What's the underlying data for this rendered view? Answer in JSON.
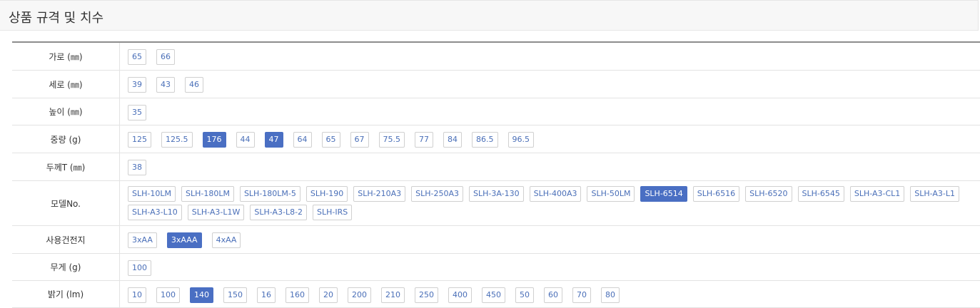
{
  "header": {
    "title": "상품 규격 및 치수"
  },
  "rows": [
    {
      "label": "가로 (㎜)",
      "values": [
        "65",
        "66"
      ],
      "selected": []
    },
    {
      "label": "세로 (㎜)",
      "values": [
        "39",
        "43",
        "46"
      ],
      "selected": []
    },
    {
      "label": "높이 (㎜)",
      "values": [
        "35"
      ],
      "selected": []
    },
    {
      "label": "중량 (g)",
      "values": [
        "125",
        "125.5",
        "176",
        "44",
        "47",
        "64",
        "65",
        "67",
        "75.5",
        "77",
        "84",
        "86.5",
        "96.5"
      ],
      "selected": [
        "176",
        "47"
      ]
    },
    {
      "label": "두께T (㎜)",
      "values": [
        "38"
      ],
      "selected": []
    },
    {
      "label": "모델No.",
      "values": [
        "SLH-10LM",
        "SLH-180LM",
        "SLH-180LM-5",
        "SLH-190",
        "SLH-210A3",
        "SLH-250A3",
        "SLH-3A-130",
        "SLH-400A3",
        "SLH-50LM",
        "SLH-6514",
        "SLH-6516",
        "SLH-6520",
        "SLH-6545",
        "SLH-A3-CL1",
        "SLH-A3-L1",
        "SLH-A3-L10",
        "SLH-A3-L1W",
        "SLH-A3-L8-2",
        "SLH-IRS"
      ],
      "selected": [
        "SLH-6514"
      ]
    },
    {
      "label": "사용건전지",
      "values": [
        "3xAA",
        "3xAAA",
        "4xAA"
      ],
      "selected": [
        "3xAAA"
      ]
    },
    {
      "label": "무게 (g)",
      "values": [
        "100"
      ],
      "selected": []
    },
    {
      "label": "밝기 (lm)",
      "values": [
        "10",
        "100",
        "140",
        "150",
        "16",
        "160",
        "20",
        "200",
        "210",
        "250",
        "400",
        "450",
        "50",
        "60",
        "70",
        "80"
      ],
      "selected": [
        "140"
      ]
    }
  ]
}
